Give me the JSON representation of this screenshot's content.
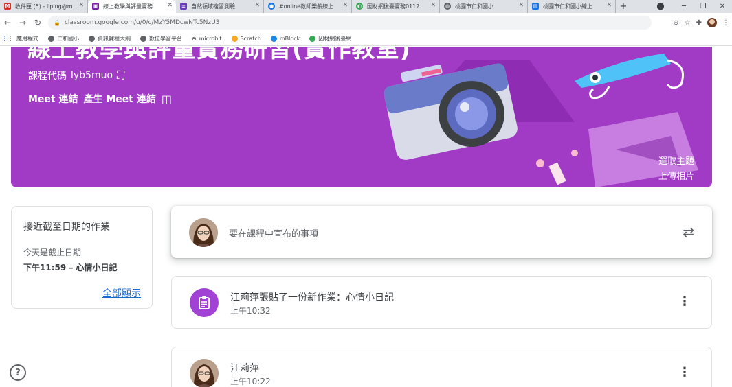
{
  "browser": {
    "tabs": [
      {
        "label": "收件匣 (5) - liping@m",
        "icon": "gmail-icon",
        "color": "#d93025"
      },
      {
        "label": "線上教學與評量實務",
        "icon": "classroom-icon",
        "color": "#7b1fa2"
      },
      {
        "label": "自然領域複習測驗",
        "icon": "forms-icon",
        "color": "#673ab7"
      },
      {
        "label": "#online教師樂齡線上",
        "icon": "site-icon",
        "color": "#1a73e8"
      },
      {
        "label": "因材網後臺實務0112",
        "icon": "site-icon",
        "color": "#34a853"
      },
      {
        "label": "桃園市仁和國小",
        "icon": "globe-icon",
        "color": "#5f6368"
      },
      {
        "label": "桃園市仁和國小線上",
        "icon": "sites-icon",
        "color": "#1a73e8"
      }
    ],
    "url": "classroom.google.com/u/0/c/MzY5MDcwNTc5NzU3",
    "bookmarks": [
      "應用程式",
      "仁和國小",
      "資訊課程大綱",
      "數位學習平台",
      "microbit",
      "Scratch",
      "mBlock",
      "因材網後臺網"
    ]
  },
  "banner": {
    "title": "線上教學與評量實務研習(實作教室)",
    "course_code_label": "課程代碼",
    "course_code": "lyb5muo",
    "meet_label": "Meet 連結",
    "meet_action": "產生 Meet 連結",
    "select_theme": "選取主題",
    "upload_photo": "上傳相片",
    "color": "#a13bc6"
  },
  "upcoming": {
    "title": "接近截至日期的作業",
    "due_label": "今天是截止日期",
    "item": "下午11:59 – 心情小日記",
    "view_all": "全部顯示"
  },
  "announce": {
    "placeholder": "要在課程中宣布的事項"
  },
  "posts": [
    {
      "title": "江莉萍張貼了一份新作業：心情小日記",
      "time": "上午10:32",
      "type": "assignment"
    },
    {
      "title": "江莉萍",
      "time": "上午10:22",
      "type": "announcement"
    }
  ],
  "help": "?"
}
